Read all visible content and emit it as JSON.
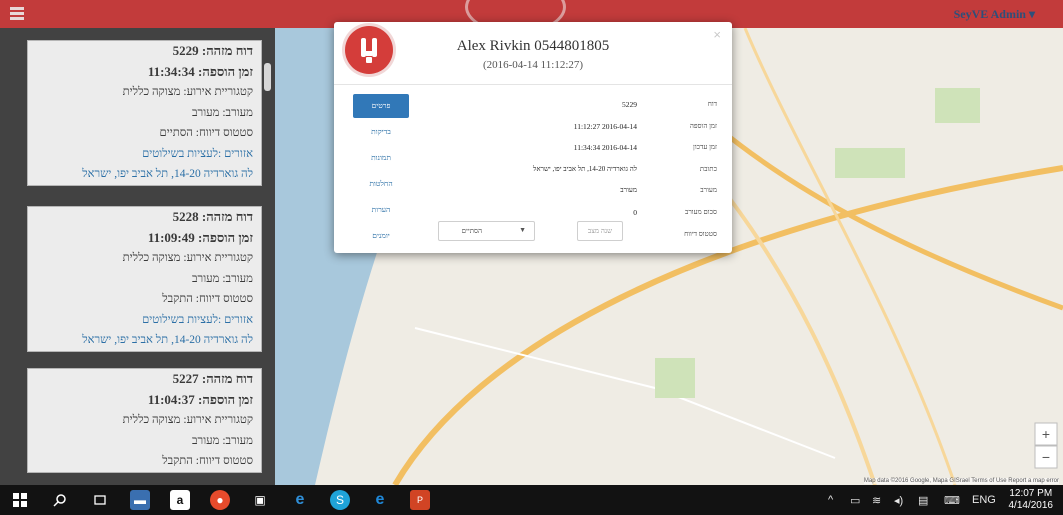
{
  "header": {
    "user_label": "SeyVE Admin ▾"
  },
  "sidebar": {
    "cards": [
      {
        "id": "5229",
        "id_label": "דוח מזהה:",
        "time": "11:34:34",
        "time_label": "זמן הוספה:",
        "category": "קטגוריית אירוע: מצוקה כללית",
        "involved": "מעורב: מעורב",
        "status": "סטטוס דיווח: הסתיים",
        "area": "אזורים :לעציות בשילוטים",
        "address": "לה גוארדיה 14-20, תל אביב יפו, ישראל"
      },
      {
        "id": "5228",
        "id_label": "דוח מזהה:",
        "time": "11:09:49",
        "time_label": "זמן הוספה:",
        "category": "קטגוריית אירוע: מצוקה כללית",
        "involved": "מעורב: מעורב",
        "status": "סטטוס דיווח: התקבל",
        "area": "אזורים :לעציות בשילוטים",
        "address": "לה גוארדיה 14-20, תל אביב יפו, ישראל"
      },
      {
        "id": "5227",
        "id_label": "דוח מזהה:",
        "time": "11:04:37",
        "time_label": "זמן הוספה:",
        "category": "קטגוריית אירוע: מצוקה כללית",
        "involved": "מעורב: מעורב",
        "status": "סטטוס דיווח: התקבל"
      }
    ]
  },
  "modal": {
    "title": "Alex Rivkin 0544801805",
    "subtitle": "(2016-04-14 11:12:27)",
    "close": "×",
    "tabs": [
      "פרטים",
      "בדיקות",
      "תמונות",
      "החלטות",
      "הערות",
      "יומנים"
    ],
    "rows": [
      {
        "label": "דוח",
        "value": "5229"
      },
      {
        "label": "זמן הוספה",
        "value": "2016-04-14 11:12:27"
      },
      {
        "label": "זמן עדכון",
        "value": "2016-04-14 11:34:34"
      },
      {
        "label": "כתובת",
        "value": "לה גוארדיה 14-20, תל אביב יפו, ישראל"
      },
      {
        "label": "מעורב",
        "value": "מעורב"
      },
      {
        "label": "סכום מעורב",
        "value": "0"
      },
      {
        "label": "סטטוס דיווח",
        "value": ""
      }
    ],
    "save_label": "שנה מצב",
    "status_select_value": "הסתיים"
  },
  "map": {
    "attribution": "Map data ©2016 Google, Mapa GISrael   Terms of Use   Report a map error"
  },
  "taskbar": {
    "language": "ENG",
    "time": "12:07 PM",
    "date": "4/14/2016"
  },
  "colors": {
    "header": "#c23b3b",
    "sidebar": "#424242",
    "accent": "#3178b8",
    "logo_red": "#d43d3a"
  }
}
